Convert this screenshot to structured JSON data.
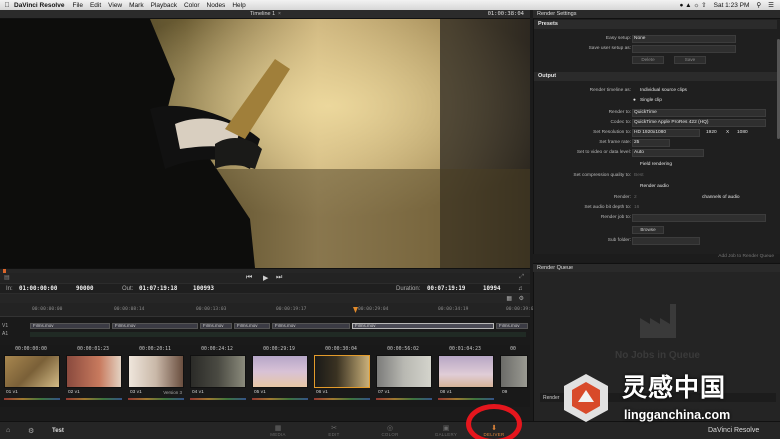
{
  "menubar": {
    "app_name": "DaVinci Resolve",
    "items": [
      "File",
      "Edit",
      "View",
      "Mark",
      "Playback",
      "Color",
      "Nodes",
      "Help"
    ],
    "clock": "Sat 1:23 PM"
  },
  "viewer": {
    "timeline_title": "Timeline 1",
    "close_glyph": "×",
    "current_tc": "01:00:38:04"
  },
  "transport": {
    "left_tool": "▤",
    "prev_glyph": "⏮",
    "play_glyph": "▶",
    "next_glyph": "⏭",
    "right_tool": "⤢"
  },
  "tcbar": {
    "in_label": "In:",
    "in_tc": "01:00:00:00",
    "in_frames": "90000",
    "out_label": "Out:",
    "out_tc": "01:07:19:18",
    "out_frames": "100993",
    "duration_label": "Duration:",
    "duration_tc": "00:07:19:19",
    "duration_frames": "10994"
  },
  "ruler": {
    "ticks": [
      "00:00:00:00",
      "00:00:08:14",
      "00:00:13:03",
      "00:00:19:17",
      "00:00:29:04",
      "00:00:34:19",
      "00:00:39:08"
    ]
  },
  "tracks": {
    "v1_label": "V1",
    "a1_label": "A1",
    "clips": [
      "Films.mov",
      "Films.mov",
      "Films.mov",
      "Films.mov",
      "Films.mov",
      "Films.mov",
      "Films.mov"
    ]
  },
  "thumbnails": [
    {
      "tc": "00:00:00:00",
      "label": "01   v1",
      "extra": ""
    },
    {
      "tc": "00:00:01:23",
      "label": "02   v1",
      "extra": ""
    },
    {
      "tc": "00:00:20:11",
      "label": "03   v1",
      "extra": "Version 3"
    },
    {
      "tc": "00:00:24:12",
      "label": "04   v1",
      "extra": ""
    },
    {
      "tc": "00:00:29:19",
      "label": "05   v1",
      "extra": ""
    },
    {
      "tc": "00:00:30:04",
      "label": "06   v1",
      "extra": ""
    },
    {
      "tc": "00:00:56:02",
      "label": "07   v1",
      "extra": ""
    },
    {
      "tc": "00:01:04:23",
      "label": "08   v1",
      "extra": ""
    },
    {
      "tc": "00",
      "label": "09",
      "extra": ""
    }
  ],
  "render_settings": {
    "title": "Render Settings",
    "presets_section": "Presets",
    "easy_setup_label": "Easy setup:",
    "easy_setup_value": "None",
    "save_user_setup_label": "Save user setup as:",
    "delete_button": "Delete",
    "save_button": "Save",
    "output_section": "Output",
    "render_timeline_as_label": "Render timeline as:",
    "individual_clips": "Individual source clips",
    "single_clip": "Single clip",
    "render_to_label": "Render to:",
    "render_to_value": "QuickTime",
    "codec_label": "Codec to:",
    "codec_value": "QuickTime Apple ProRes 422 (HQ)",
    "resolution_label": "Set Resolution to:",
    "resolution_value": "HD 1920x1080",
    "res_width": "1920",
    "res_x": "X",
    "res_height": "1080",
    "frame_rate_label": "Set frame rate:",
    "frame_rate_value": "25",
    "data_levels_label": "Set to video or data level:",
    "data_levels_value": "Auto",
    "field_rendering": "Field rendering",
    "compression_label": "Set compression quality to:",
    "compression_value": "Best",
    "render_audio": "Render audio",
    "render_label": "Render:",
    "render_value": "2",
    "channels_label": "channels of audio",
    "audio_bit_depth_label": "Set audio bit depth to:",
    "audio_bit_depth_value": "16",
    "render_job_to_label": "Render job to:",
    "browse_button": "Browse",
    "sub_folder_label": "Sub folder:",
    "add_job_button": "Add Job to Render Queue"
  },
  "render_queue": {
    "title": "Render Queue",
    "empty_text": "No Jobs in Queue",
    "render_bar_text": "Render"
  },
  "pagebar": {
    "project_name": "Test",
    "tabs": [
      {
        "label": "MEDIA",
        "glyph": "▦"
      },
      {
        "label": "EDIT",
        "glyph": "✂"
      },
      {
        "label": "COLOR",
        "glyph": "◎"
      },
      {
        "label": "GALLERY",
        "glyph": "▣"
      },
      {
        "label": "DELIVER",
        "glyph": "⬇"
      }
    ]
  },
  "watermark": {
    "cn_text": "灵感中国",
    "url_text": "lingganchina.com",
    "brand_text": "DaVinci Resolve"
  },
  "colors": {
    "accent": "#e2873a",
    "highlight_circle": "#e5161d"
  }
}
